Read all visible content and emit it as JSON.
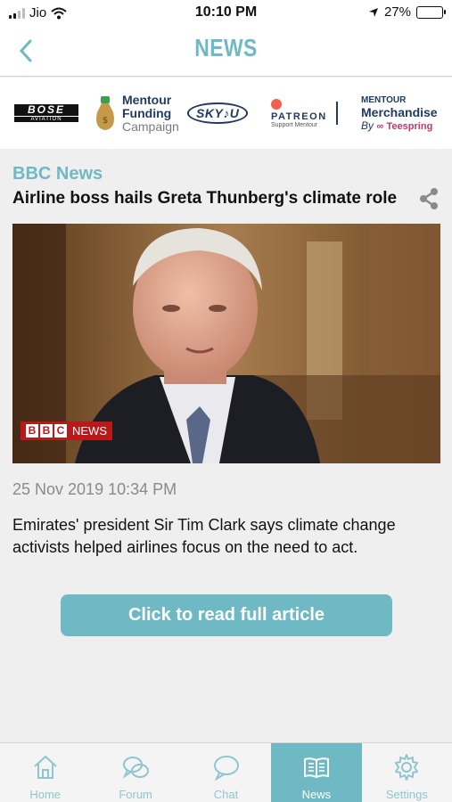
{
  "status_bar": {
    "carrier": "Jio",
    "time": "10:10 PM",
    "battery": "27%",
    "battery_level": 0.27
  },
  "header": {
    "title": "NEWS",
    "back_icon": "chevron-left-icon"
  },
  "sponsors": {
    "bose": {
      "name": "BOSE",
      "sub": "AVIATION"
    },
    "mentour": {
      "line1": "Mentour",
      "line2": "Funding",
      "line3": "Campaign"
    },
    "skyou": {
      "name": "SKY♪U"
    },
    "patreon": {
      "name": "PATREON",
      "sub": "Support Mentour"
    },
    "merch": {
      "line1": "MENTOUR",
      "line2": "Merchandise",
      "by": "By",
      "brand": "Teespring"
    }
  },
  "article": {
    "source": "BBC News",
    "headline": "Airline boss hails Greta Thunberg's climate role",
    "share_icon": "share-icon",
    "photo_badge_bbc": "BBC",
    "photo_badge_news": "NEWS",
    "date": "25 Nov 2019 10:34 PM",
    "summary": "Emirates' president Sir Tim Clark says climate change activists helped airlines focus on the need to act.",
    "read_button": "Click to read full article"
  },
  "tabs": [
    {
      "label": "Home",
      "icon": "home-icon",
      "active": false
    },
    {
      "label": "Forum",
      "icon": "forum-icon",
      "active": false
    },
    {
      "label": "Chat",
      "icon": "chat-icon",
      "active": false
    },
    {
      "label": "News",
      "icon": "news-icon",
      "active": true
    },
    {
      "label": "Settings",
      "icon": "gear-icon",
      "active": false
    }
  ],
  "colors": {
    "accent": "#6fb9c4",
    "navy": "#1f3b63",
    "bbc_red": "#bb1919"
  }
}
